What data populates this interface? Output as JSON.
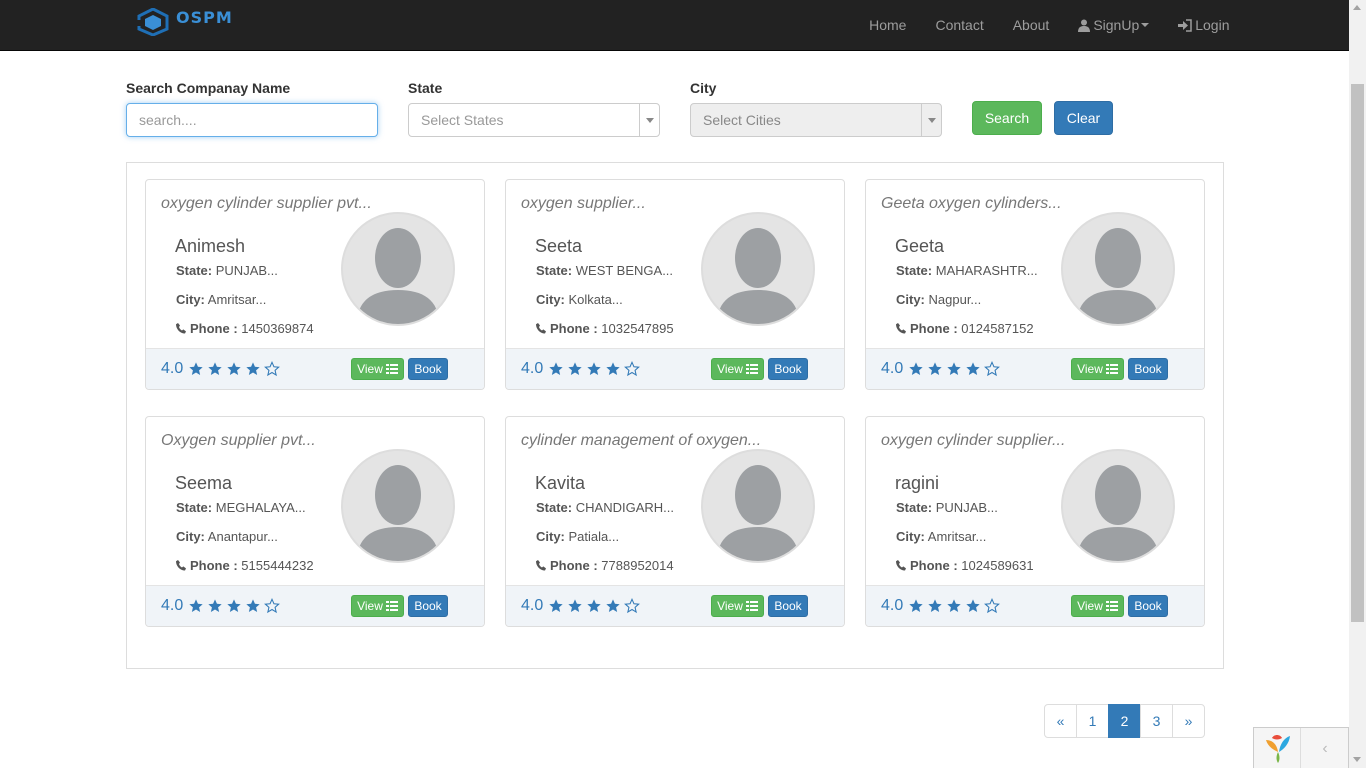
{
  "navbar": {
    "brand": "OSPM",
    "links": {
      "home": "Home",
      "contact": "Contact",
      "about": "About",
      "signup": "SignUp",
      "login": "Login"
    }
  },
  "filters": {
    "company_label": "Search Companay Name",
    "company_placeholder": "search....",
    "state_label": "State",
    "state_value": "Select States",
    "city_label": "City",
    "city_value": "Select Cities",
    "search_button": "Search",
    "clear_button": "Clear"
  },
  "labels": {
    "state": "State:",
    "city": "City:",
    "phone": "Phone :",
    "view": "View",
    "book": "Book"
  },
  "cards": [
    {
      "company": "oxygen cylinder supplier pvt...",
      "name": "Animesh",
      "state": "PUNJAB...",
      "city": "Amritsar...",
      "phone": "1450369874",
      "rating": "4.0",
      "stars": 4
    },
    {
      "company": "oxygen supplier...",
      "name": "Seeta",
      "state": "WEST BENGA...",
      "city": "Kolkata...",
      "phone": "1032547895",
      "rating": "4.0",
      "stars": 4
    },
    {
      "company": "Geeta oxygen cylinders...",
      "name": "Geeta",
      "state": "MAHARASHTR...",
      "city": "Nagpur...",
      "phone": "0124587152",
      "rating": "4.0",
      "stars": 4
    },
    {
      "company": "Oxygen supplier pvt...",
      "name": "Seema",
      "state": "MEGHALAYA...",
      "city": "Anantapur...",
      "phone": "5155444232",
      "rating": "4.0",
      "stars": 4
    },
    {
      "company": "cylinder management of oxygen...",
      "name": "Kavita",
      "state": "CHANDIGARH...",
      "city": "Patiala...",
      "phone": "7788952014",
      "rating": "4.0",
      "stars": 4
    },
    {
      "company": "oxygen cylinder supplier...",
      "name": "ragini",
      "state": "PUNJAB...",
      "city": "Amritsar...",
      "phone": "1024589631",
      "rating": "4.0",
      "stars": 4
    }
  ],
  "pagination": {
    "prev": "«",
    "pages": [
      "1",
      "2",
      "3"
    ],
    "active": "2",
    "next": "»"
  },
  "colors": {
    "navbar": "#222222",
    "primary": "#337ab7",
    "success": "#5cb85c",
    "brand": "#3a8fd6"
  },
  "debug_toolbar": {
    "toggle": "‹"
  }
}
